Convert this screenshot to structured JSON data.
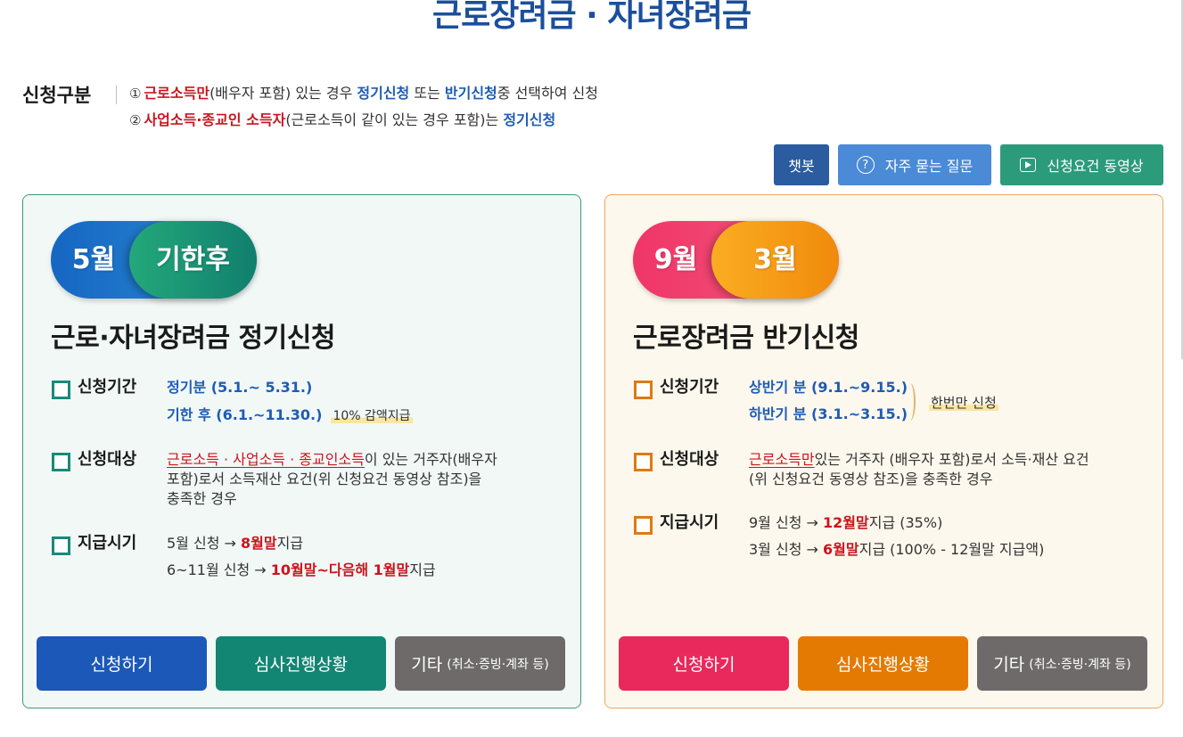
{
  "colors": {
    "title": "#1b4f9c",
    "red": "#c9151e",
    "blue": "#1d5cb6",
    "regular_border": "#3a9c80",
    "regular_bg": "#f1f8f6",
    "semiannual_border": "#e9a864",
    "semiannual_bg": "#fdf8ed",
    "chatbot": "#2a5c9f",
    "faq": "#4b8ad6",
    "video": "#2c9b7b",
    "regular_apply": "#1b58b8",
    "regular_status": "#138573",
    "semiannual_apply": "#e9285c",
    "semiannual_status": "#e57a02",
    "other_button": "#6e6a6a"
  },
  "icons": {
    "bullet": "square-bullet-icon"
  },
  "page": {
    "title": "근로장려금 · 자녀장려금"
  },
  "category": {
    "label": "신청구분",
    "lines": [
      {
        "num": "①",
        "segments": [
          "근로소득만",
          "(배우자 포함) 있는 경우 ",
          "정기신청",
          " 또는 ",
          "반기신청",
          "중 선택하여 신청"
        ]
      },
      {
        "num": "②",
        "segments": [
          "사업소득·종교인 소득자",
          "(근로소득이 같이 있는 경우 포함)는 ",
          "정기신청"
        ]
      }
    ]
  },
  "toolbar": {
    "chatbot": {
      "label": "챗봇"
    },
    "faq": {
      "label": "자주 묻는 질문",
      "icon": "question-circle-icon"
    },
    "video": {
      "label": "신청요건 동영상",
      "icon": "play-icon"
    }
  },
  "regular": {
    "pill_primary": "5월",
    "pill_secondary": "기한후",
    "heading": "근로·자녀장려금 정기신청",
    "period": {
      "label": "신청기간",
      "lines": [
        "정기분 (5.1.~ 5.31.)",
        "기한 후 (6.1.~11.30.)"
      ],
      "note": "10% 감액지급"
    },
    "target": {
      "label": "신청대상",
      "highlight": "근로소득 · 사업소득 · 종교인소득",
      "lines": [
        "이 있는 거주자(배우자",
        "포함)로서 소득재산 요건(위 신청요건 동영상 참조)을",
        "충족한 경우"
      ]
    },
    "payment": {
      "label": "지급시기",
      "lines": [
        {
          "before": "5월 신청 → ",
          "highlight": "8월말",
          "after": "지급"
        },
        {
          "before": "6~11월 신청 → ",
          "highlight": "10월말~다음해 1월말",
          "after": "지급"
        }
      ]
    },
    "buttons": {
      "apply": "신청하기",
      "status": "심사진행상황",
      "other": "기타",
      "other_detail": "(취소·증빙·계좌 등)"
    }
  },
  "semiannual": {
    "pill_primary": "9월",
    "pill_secondary": "3월",
    "heading": "근로장려금 반기신청",
    "period": {
      "label": "신청기간",
      "lines": [
        "상반기 분 (9.1.~9.15.)",
        "하반기 분 (3.1.~3.15.)"
      ],
      "note": "한번만 신청"
    },
    "target": {
      "label": "신청대상",
      "highlight": "근로소득만",
      "lines": [
        "있는 거주자 (배우자 포함)로서 소득·재산 요건",
        "(위 신청요건 동영상 참조)을 충족한 경우"
      ]
    },
    "payment": {
      "label": "지급시기",
      "lines": [
        {
          "before": "9월 신청 → ",
          "highlight": "12월말",
          "after": "지급 (35%)"
        },
        {
          "before": "3월 신청 → ",
          "highlight": "6월말",
          "after": "지급 (100% - 12월말 지급액)"
        }
      ]
    },
    "buttons": {
      "apply": "신청하기",
      "status": "심사진행상황",
      "other": "기타",
      "other_detail": "(취소·증빙·계좌 등)"
    }
  }
}
